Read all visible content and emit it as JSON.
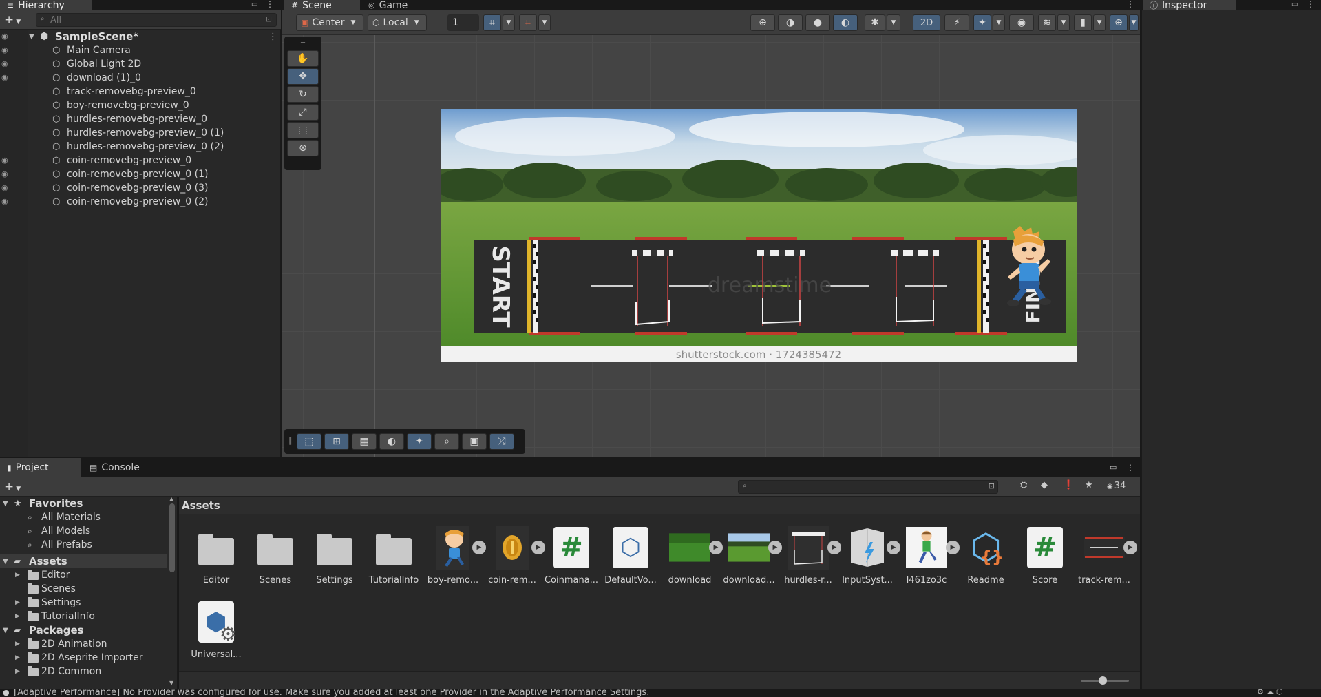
{
  "hierarchy": {
    "tab_label": "Hierarchy",
    "search_placeholder": "All",
    "scene_name": "SampleScene*",
    "items": [
      {
        "label": "Main Camera",
        "eye": true
      },
      {
        "label": "Global Light 2D",
        "eye": true
      },
      {
        "label": "download (1)_0",
        "eye": true
      },
      {
        "label": "track-removebg-preview_0",
        "eye": false
      },
      {
        "label": "boy-removebg-preview_0",
        "eye": false
      },
      {
        "label": "hurdles-removebg-preview_0",
        "eye": false
      },
      {
        "label": "hurdles-removebg-preview_0 (1)",
        "eye": false
      },
      {
        "label": "hurdles-removebg-preview_0 (2)",
        "eye": false
      },
      {
        "label": "coin-removebg-preview_0",
        "eye": true
      },
      {
        "label": "coin-removebg-preview_0 (1)",
        "eye": true
      },
      {
        "label": "coin-removebg-preview_0 (3)",
        "eye": true
      },
      {
        "label": "coin-removebg-preview_0 (2)",
        "eye": true
      }
    ]
  },
  "scene": {
    "tab_scene": "Scene",
    "tab_game": "Game",
    "pivot_label": "Center",
    "space_label": "Local",
    "grid_snap_value": "1",
    "mode_2d_label": "2D",
    "image_text": {
      "start": "START",
      "finish": "FINISH",
      "watermark": "dreamstime",
      "footer": "shutterstock.com · 1724385472"
    }
  },
  "inspector": {
    "tab_label": "Inspector"
  },
  "project": {
    "tab_project": "Project",
    "tab_console": "Console",
    "breadcrumb": "Assets",
    "visible_count": "34",
    "favorites": {
      "label": "Favorites",
      "items": [
        "All Materials",
        "All Models",
        "All Prefabs"
      ]
    },
    "assets_tree": {
      "label": "Assets",
      "items": [
        "Editor",
        "Scenes",
        "Settings",
        "TutorialInfo"
      ]
    },
    "packages_tree": {
      "label": "Packages",
      "items": [
        "2D Animation",
        "2D Aseprite Importer",
        "2D Common"
      ]
    },
    "assets": [
      {
        "label": "Editor",
        "kind": "folder"
      },
      {
        "label": "Scenes",
        "kind": "folder"
      },
      {
        "label": "Settings",
        "kind": "folder"
      },
      {
        "label": "TutorialInfo",
        "kind": "folder"
      },
      {
        "label": "boy-remo...",
        "kind": "boy"
      },
      {
        "label": "coin-rem...",
        "kind": "coin"
      },
      {
        "label": "Coinmana...",
        "kind": "script"
      },
      {
        "label": "DefaultVo...",
        "kind": "volume"
      },
      {
        "label": "download",
        "kind": "grass"
      },
      {
        "label": "download...",
        "kind": "field"
      },
      {
        "label": "hurdles-r...",
        "kind": "hurdle"
      },
      {
        "label": "InputSyst...",
        "kind": "input"
      },
      {
        "label": "l461zo3c",
        "kind": "runner"
      },
      {
        "label": "Readme",
        "kind": "readme"
      },
      {
        "label": "Score",
        "kind": "script"
      },
      {
        "label": "track-rem...",
        "kind": "track"
      },
      {
        "label": "Universal...",
        "kind": "settings"
      }
    ]
  },
  "status": {
    "message": "[Adaptive Performance] No Provider was configured for use. Make sure you added at least one Provider in the Adaptive Performance Settings."
  },
  "colors": {
    "accent": "#46607c",
    "panel": "#282828",
    "toolbar": "#3c3c3c",
    "scene_bg": "#444444"
  }
}
